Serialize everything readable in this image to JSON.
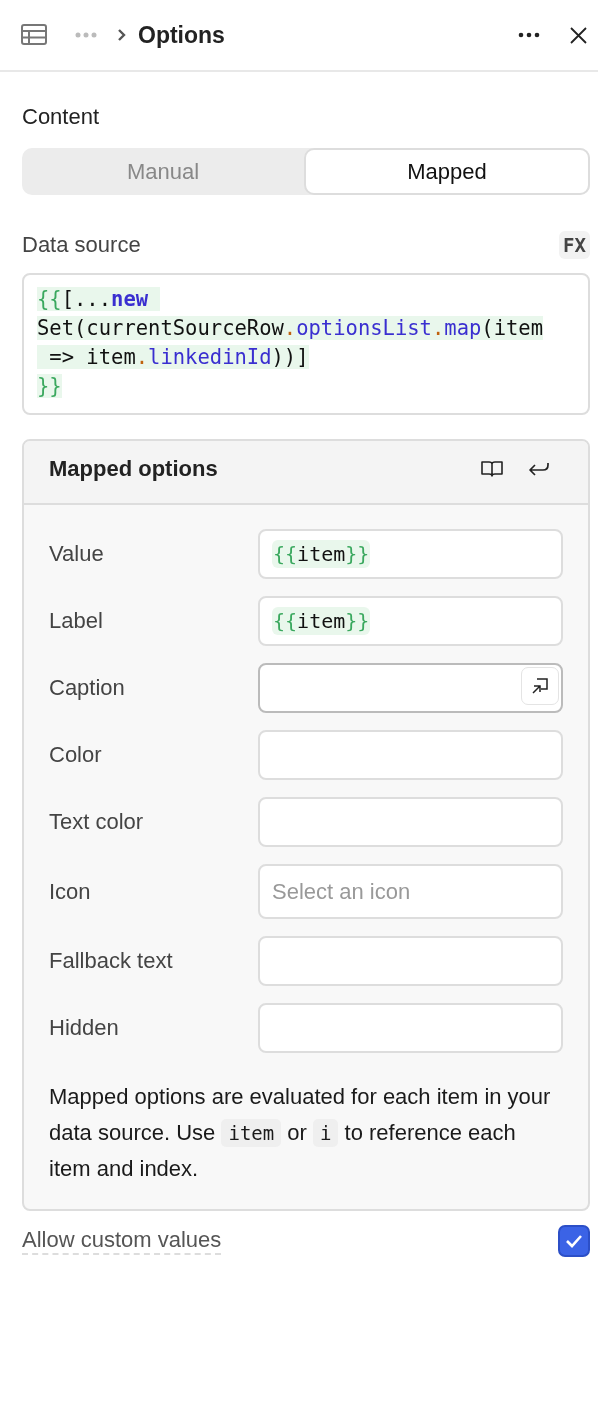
{
  "header": {
    "title": "Options"
  },
  "content": {
    "heading": "Content",
    "tabs": [
      {
        "label": "Manual",
        "selected": false
      },
      {
        "label": "Mapped",
        "selected": true
      }
    ]
  },
  "data_source": {
    "label": "Data source",
    "badge": "FX",
    "lines": [
      [
        {
          "text": "{{",
          "kind": "brace"
        },
        {
          "text": "[...",
          "kind": "plain"
        },
        {
          "text": "new ",
          "kind": "keyword"
        }
      ],
      [
        {
          "text": "Set(currentSourceRow",
          "kind": "plain"
        },
        {
          "text": ".",
          "kind": "dot"
        },
        {
          "text": "optionsList",
          "kind": "prop"
        },
        {
          "text": ".",
          "kind": "dot"
        },
        {
          "text": "map",
          "kind": "prop"
        },
        {
          "text": "(item",
          "kind": "plain"
        }
      ],
      [
        {
          "text": " => item",
          "kind": "plain"
        },
        {
          "text": ".",
          "kind": "dot"
        },
        {
          "text": "linkedinId",
          "kind": "prop"
        },
        {
          "text": "))]",
          "kind": "plain"
        }
      ],
      [
        {
          "text": "}}",
          "kind": "brace"
        }
      ]
    ]
  },
  "mapped_options": {
    "title": "Mapped options",
    "fields": [
      {
        "label": "Value",
        "value": [
          {
            "text": "{{",
            "kind": "brace"
          },
          {
            "text": "item",
            "kind": "plain"
          },
          {
            "text": "}}",
            "kind": "brace"
          }
        ]
      },
      {
        "label": "Label",
        "value": [
          {
            "text": "{{",
            "kind": "brace"
          },
          {
            "text": "item",
            "kind": "plain"
          },
          {
            "text": "}}",
            "kind": "brace"
          }
        ]
      },
      {
        "label": "Caption",
        "expand": true
      },
      {
        "label": "Color"
      },
      {
        "label": "Text color"
      },
      {
        "label": "Icon",
        "placeholder": "Select an icon"
      },
      {
        "label": "Fallback text"
      },
      {
        "label": "Hidden"
      }
    ],
    "hint": [
      {
        "text": "Mapped options are evaluated for each item in your data source. Use ",
        "kind": "text"
      },
      {
        "text": "item",
        "kind": "code"
      },
      {
        "text": " or ",
        "kind": "text"
      },
      {
        "text": "i",
        "kind": "code"
      },
      {
        "text": " to reference each item and index.",
        "kind": "text"
      }
    ]
  },
  "allow_custom_values": {
    "label": "Allow custom values",
    "checked": true
  }
}
